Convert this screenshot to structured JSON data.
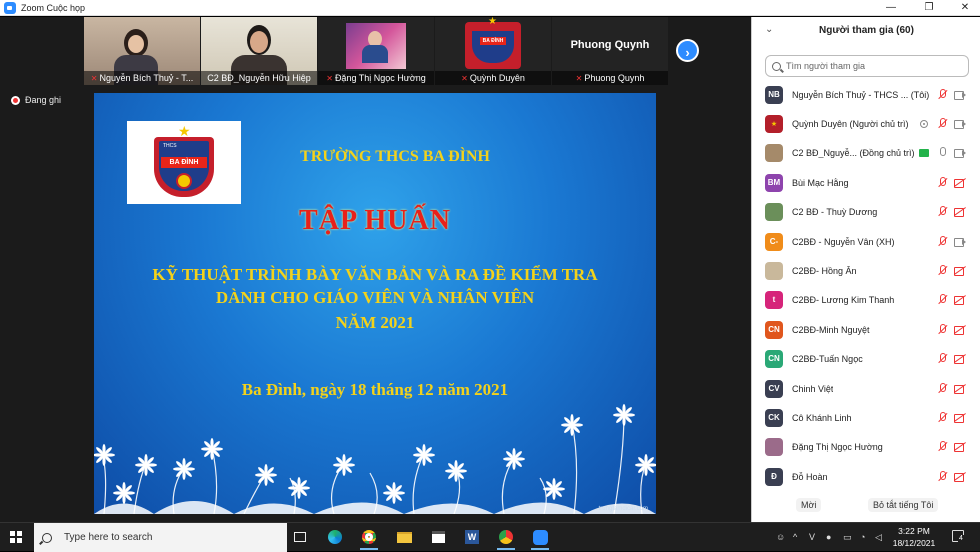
{
  "window": {
    "title": "Zoom Cuộc họp",
    "minimize_glyph": "—",
    "maximize_glyph": "❐",
    "close_glyph": "✕"
  },
  "thumbnails": [
    {
      "name": "Nguyễn Bích Thuỷ - T...",
      "muted": true
    },
    {
      "name": "C2 BĐ_Nguyễn Hữu Hiệp",
      "muted": false,
      "active": true
    },
    {
      "name": "Đặng Thị Ngọc Hường",
      "muted": true
    },
    {
      "name": "Quỳnh Duyên",
      "muted": true
    },
    {
      "name": "Phuong Quynh",
      "muted": true,
      "display_name": "Phuong Quynh"
    }
  ],
  "next_glyph": "›",
  "recording_label": "Đang ghi",
  "slide": {
    "logo_text": "BA ĐÌNH",
    "logo_small": "THCS",
    "school": "TRƯỜNG THCS BA ĐÌNH",
    "title": "TẬP HUẤN",
    "line1": "KỸ THUẬT TRÌNH BÀY VĂN BẢN VÀ RA ĐỀ KIỂM TRA",
    "line2": "DÀNH CHO GIÁO VIÊN VÀ NHÂN VIÊN",
    "line3": "NĂM 2021",
    "date": "Ba Đình, ngày 18 tháng 12 năm 2021",
    "watermark": "trungtamdicar.com"
  },
  "panel": {
    "title": "Người tham gia (60)",
    "collapse_glyph": "⌄",
    "search_placeholder": "Tìm người tham gia",
    "participants": [
      {
        "initials": "NB",
        "color": "#3a3f52",
        "name": "Nguyễn Bích Thuỷ - THCS ... (Tôi)",
        "mic": "off",
        "cam": "off"
      },
      {
        "initials": "",
        "color": "#b31f2a",
        "name": "Quỳnh Duyên (Người chủ trì)",
        "mic": "off",
        "cam": "on",
        "dot": true
      },
      {
        "initials": "",
        "color": "#a58a6a",
        "name": "C2 BĐ_Nguyễ... (Đồng chủ trì)",
        "mic": "on",
        "cam": "on",
        "share": true
      },
      {
        "initials": "BM",
        "color": "#8e44ad",
        "name": "Bùi Mạc Hằng",
        "mic": "off",
        "cam": "off"
      },
      {
        "initials": "",
        "color": "#6b8f5a",
        "name": "C2 BĐ - Thuỳ Dương",
        "mic": "off",
        "cam": "off"
      },
      {
        "initials": "C-",
        "color": "#f08c1a",
        "name": "C2BĐ - Nguyễn Vân (XH)",
        "mic": "off",
        "cam": "on"
      },
      {
        "initials": "",
        "color": "#c9b89b",
        "name": "C2BĐ- Hồng Ân",
        "mic": "off",
        "cam": "off"
      },
      {
        "initials": "t",
        "color": "#d6247a",
        "name": "C2BĐ- Lương Kim Thanh",
        "mic": "off",
        "cam": "off"
      },
      {
        "initials": "CN",
        "color": "#e0561d",
        "name": "C2BĐ-Minh Nguyệt",
        "mic": "off",
        "cam": "off"
      },
      {
        "initials": "CN",
        "color": "#2aa876",
        "name": "C2BĐ-Tuấn Ngọc",
        "mic": "off",
        "cam": "off"
      },
      {
        "initials": "CV",
        "color": "#3a3f52",
        "name": "Chinh Việt",
        "mic": "off",
        "cam": "off"
      },
      {
        "initials": "CK",
        "color": "#3a3f52",
        "name": "Cô Khánh Linh",
        "mic": "off",
        "cam": "off"
      },
      {
        "initials": "",
        "color": "#9b6b8a",
        "name": "Đặng Thị Ngọc Hường",
        "mic": "off",
        "cam": "off"
      },
      {
        "initials": "Đ",
        "color": "#3a3f52",
        "name": "Đỗ Hoàn",
        "mic": "off",
        "cam": "off"
      }
    ],
    "invite_label": "Mời",
    "mute_all_label": "Bỏ tắt tiếng Tôi"
  },
  "taskbar": {
    "search_text": "Type here to search",
    "time": "3:22 PM",
    "date": "18/12/2021",
    "notification_count": "4"
  }
}
